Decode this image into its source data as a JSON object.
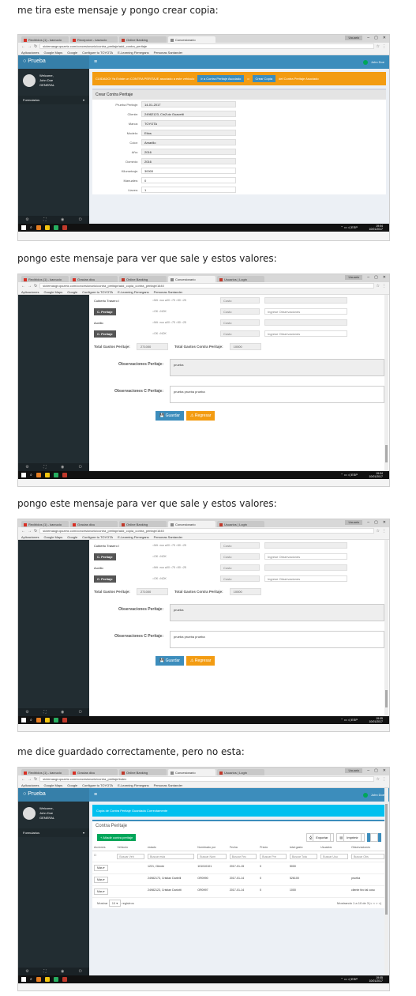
{
  "captions": [
    "me tira este mensaje y pongo crear copia:",
    "pongo este mensaje para ver que sale y estos valores:",
    "pongo este mensaje para ver que sale y estos valores:",
    "me dice guardado correctamente, pero no esta:"
  ],
  "browser": {
    "tabs1": [
      "Recibidos (1) - karzucio",
      "Recepcion - karzucio",
      "Online Banking",
      "Concesionario",
      "Usuarios | Login"
    ],
    "tabs2": [
      "Recibidos (1) - karzucio",
      "Gracias dicu",
      "Online Banking",
      "Concesionario",
      "Usuarios | Login"
    ],
    "url1": "sictemasgrupozetz.com/concesionario/contra_peritaje/add_contra_peritaje",
    "url2": "sictemasgrupozetz.com/concesionario/contra_peritaje/add_copia_contra_peritaje/1640",
    "url4": "sictemasgrupozetz.com/concesionario/contra_peritaje/index",
    "bookmarks": [
      "Aplicaciones",
      "Google Maps",
      "Google",
      "Configure tu TOYOTA",
      "E-Learning Firmegans",
      "Personas Santander"
    ],
    "user_chip": "Usuario"
  },
  "app": {
    "logo": "Prueba",
    "welcome": "Welcome,",
    "user_name": "John Doe",
    "role": "GENERAL",
    "menu_item": "Formularios",
    "top_user": "John Doe"
  },
  "shot1": {
    "alert_text": "CUIDADO! Ya Existe un CONTRA PERITAJE asociado a este vehiculo",
    "alert_btn1": "Ir a Contra Peritaje Asociado",
    "alert_mid": "o",
    "alert_btn2": "Crear Copia",
    "alert_tail": "del Contra Peritaje Asociado",
    "box_title": "Crear Contra Peritaje",
    "fields": [
      {
        "label": "Prueba Peritaje:",
        "value": "14-01-2017"
      },
      {
        "label": "Cliente:",
        "value": "24982123, CinZuio Guacetti"
      },
      {
        "label": "Marca:",
        "value": "TOYOTA"
      },
      {
        "label": "Modelo:",
        "value": "Etios"
      },
      {
        "label": "Color:",
        "value": "Amarillo"
      },
      {
        "label": "Año:",
        "value": "2016"
      },
      {
        "label": "Dominio:",
        "value": "2016"
      },
      {
        "label": "Kilometraje:",
        "value": "30000"
      },
      {
        "label": "Manuales:",
        "value": "0"
      },
      {
        "label": "Llaves:",
        "value": "1"
      }
    ]
  },
  "shot2": {
    "rows": [
      {
        "label": "Cubierto Trasero I",
        "opts": "○Mit ○ruo ●00 ○75 ○50 ○25",
        "cost": "Costo",
        "obs": ""
      },
      {
        "label": "C. Peritaje",
        "btn": true,
        "opts": "○OK ○NOK",
        "cost": "Costo",
        "obs": "Ingrese Observaciones"
      },
      {
        "label": "Auxilio",
        "opts": "○Mit ○ruo ●00 ○75 ○50 ○25",
        "cost": "Costo",
        "obs": ""
      },
      {
        "label": "C. Peritaje",
        "btn": true,
        "opts": "○OK ○NOK",
        "cost": "Costo",
        "obs": "Ingrese Observaciones"
      }
    ],
    "total_label": "Total Gastos Peritaje:",
    "total_value": "271000",
    "total_cp_label": "Total Gastos Contra Peritaje:",
    "total_cp_value": "10000",
    "obs_label": "Observaciones Peritaje:",
    "obs_value": "prueba",
    "obs_cp_label": "Observaciones C Peritaje:",
    "obs_cp_value": "prueba prueba prueba",
    "save": "Guardar",
    "back": "Regresar"
  },
  "shot4": {
    "info": "Copia de Contra Peritaje Guardada Correctamente",
    "box_title": "Contra Peritaje",
    "add": "Añadir contra peritaje",
    "export": "Exportar",
    "print": "Imprimir",
    "headers": [
      "Acciones",
      "Vehiculo",
      "estado",
      "Nombrado por",
      "Fecha",
      "Precio",
      "total gasto",
      "Usuarios",
      "Observaciones"
    ],
    "filters": [
      "Buscar Veh",
      "Buscar esta",
      "Buscar Nom",
      "Buscar Fec",
      "Buscar Pre",
      "Buscar Tota",
      "Buscar Usu",
      "Buscar Obs"
    ],
    "rows": [
      {
        "action": "Mas",
        "vehiculo": "",
        "estado": "1221, Cliente",
        "nombrado": "101010101",
        "fecha": "2017-01-15",
        "precio": "0",
        "total": "5000",
        "usuario": "",
        "obs": ""
      },
      {
        "action": "Mas",
        "vehiculo": "",
        "estado": "24982173, Cristian Dartelli",
        "nombrado": "OR0990",
        "fecha": "2017-01-14",
        "precio": "0",
        "total": "526100",
        "usuario": "",
        "obs": "prueba"
      },
      {
        "action": "Mas",
        "vehiculo": "",
        "estado": "24982123, Cristian Dariotti",
        "nombrado": "OR0997",
        "fecha": "2017-01-14",
        "precio": "0",
        "total": "1000",
        "usuario": "",
        "obs": "cliente tiro tal coso"
      }
    ],
    "show": "Mostrar",
    "per_page": "10",
    "registros": "registros",
    "range": "Mostrando 1 a 10 de 3"
  },
  "taskbar": {
    "time1": "19:04",
    "date1": "10/01/2017",
    "time2": "19:05",
    "date2": "10/01/2017",
    "lang": "ESP"
  }
}
